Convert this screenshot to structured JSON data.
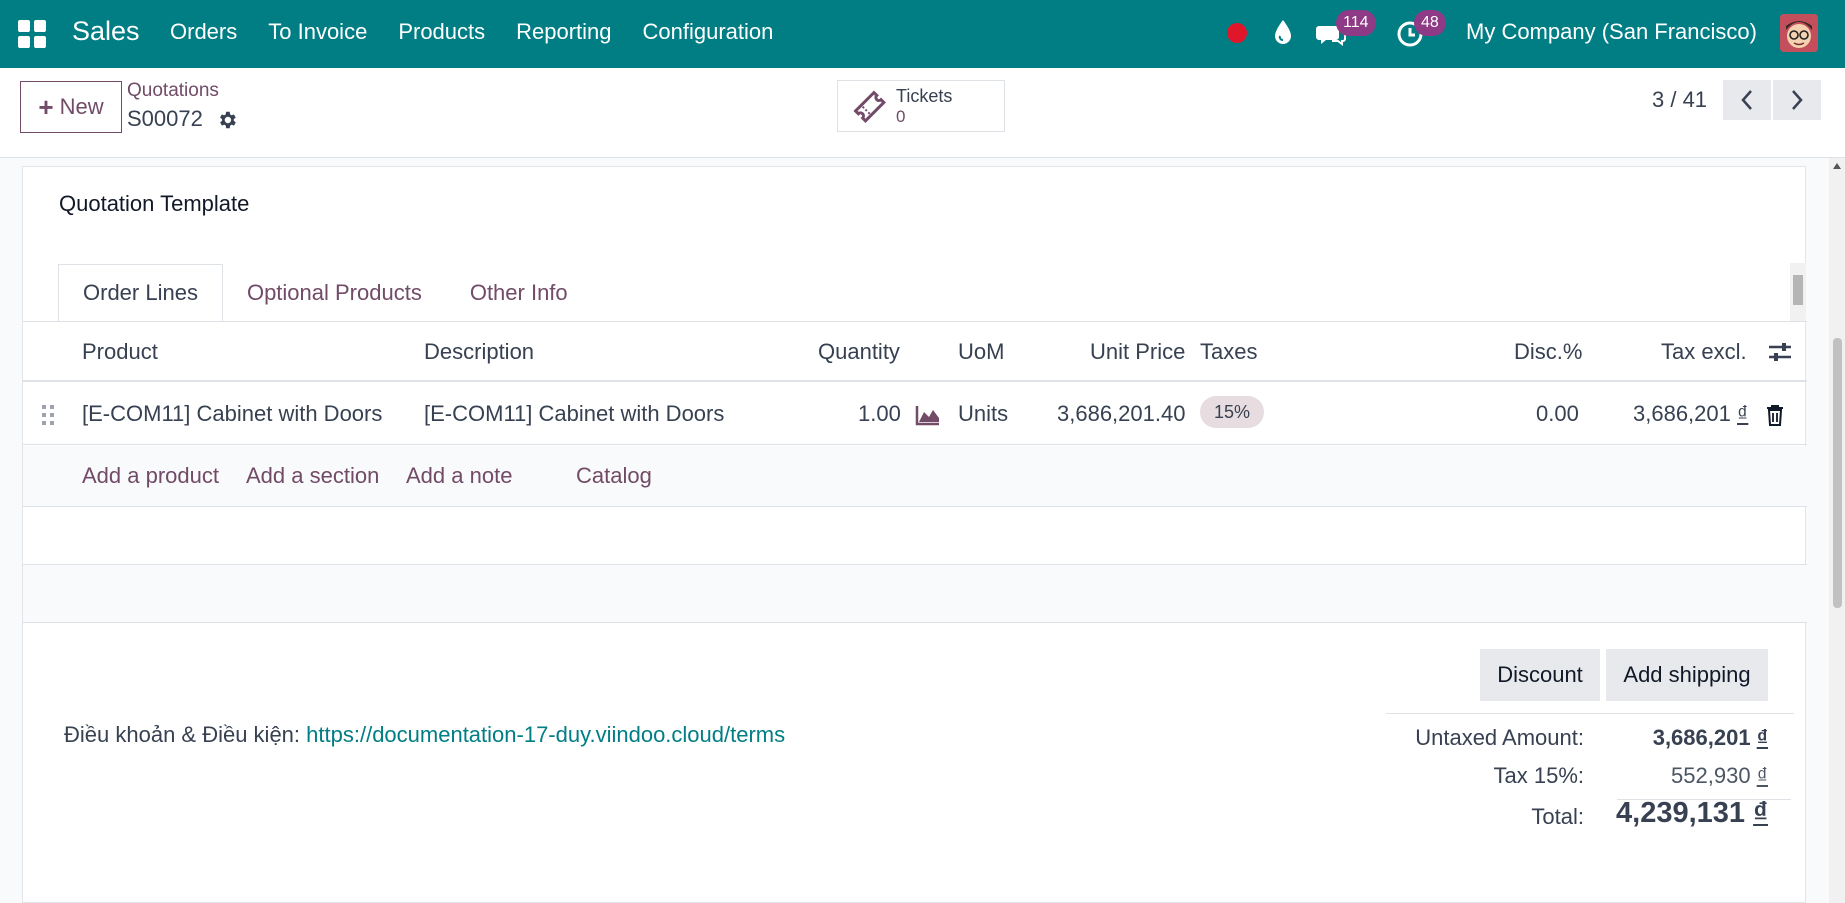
{
  "navbar": {
    "brand": "Sales",
    "menu": [
      "Orders",
      "To Invoice",
      "Products",
      "Reporting",
      "Configuration"
    ],
    "messages_count": "114",
    "activities_count": "48",
    "company": "My Company (San Francisco)"
  },
  "control": {
    "new_label": "New",
    "breadcrumb_parent": "Quotations",
    "breadcrumb_current": "S00072",
    "tickets_label": "Tickets",
    "tickets_count": "0",
    "pager": "3 / 41"
  },
  "form": {
    "quotation_template_label": "Quotation Template",
    "tabs": [
      "Order Lines",
      "Optional Products",
      "Other Info"
    ],
    "columns": {
      "product": "Product",
      "description": "Description",
      "quantity": "Quantity",
      "uom": "UoM",
      "unit_price": "Unit Price",
      "taxes": "Taxes",
      "discount": "Disc.%",
      "tax_excl": "Tax excl."
    },
    "lines": [
      {
        "product": "[E-COM11] Cabinet with Doors",
        "description": "[E-COM11] Cabinet with Doors",
        "quantity": "1.00",
        "uom": "Units",
        "unit_price": "3,686,201.40",
        "tax": "15%",
        "discount": "0.00",
        "subtotal": "3,686,201",
        "currency": "₫"
      }
    ],
    "add_links": [
      "Add a product",
      "Add a section",
      "Add a note",
      "Catalog"
    ],
    "terms_label": "Điều khoản & Điều kiện:",
    "terms_url": "https://documentation-17-duy.viindoo.cloud/terms",
    "discount_button": "Discount",
    "shipping_button": "Add shipping",
    "totals": {
      "untaxed_label": "Untaxed Amount:",
      "untaxed_value": "3,686,201",
      "tax_label": "Tax 15%:",
      "tax_value": "552,930",
      "total_label": "Total:",
      "total_value": "4,239,131",
      "currency": "₫"
    }
  },
  "colors": {
    "navbar": "#017e84",
    "primary": "#714b67",
    "badge": "#8f3a84",
    "link": "#017e84",
    "record_dot": "#e0162b"
  }
}
